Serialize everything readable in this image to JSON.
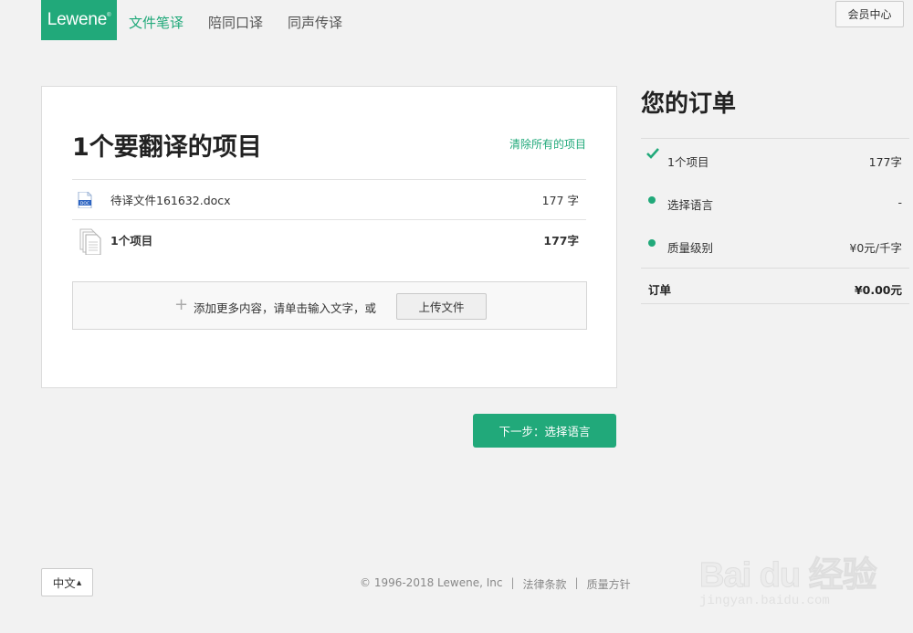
{
  "header": {
    "logo_text": "Lewene",
    "logo_mark": "®",
    "nav": [
      {
        "label": "文件笔译",
        "active": true
      },
      {
        "label": "陪同口译",
        "active": false
      },
      {
        "label": "同声传译",
        "active": false
      }
    ],
    "member_button": "会员中心"
  },
  "main": {
    "title": "1个要翻译的项目",
    "clear_link": "清除所有的项目",
    "file": {
      "name": "待译文件161632.docx",
      "count": "177 字",
      "icon": "doc-file-icon"
    },
    "summary": {
      "label": "1个项目",
      "count": "177字",
      "icon": "files-stack-icon"
    },
    "upload": {
      "plus": "+",
      "text": "添加更多内容，请单击输入文字，或",
      "button": "上传文件"
    },
    "next_button": "下一步：选择语言"
  },
  "order": {
    "title": "您的订单",
    "items": [
      {
        "label": "1个项目",
        "value": "177字",
        "status": "done"
      },
      {
        "label": "选择语言",
        "value": "-",
        "status": "pending"
      },
      {
        "label": "质量级别",
        "value": "¥0元/千字",
        "status": "pending"
      }
    ],
    "total_label": "订单",
    "total_value": "¥0.00元"
  },
  "footer": {
    "language": "中文",
    "copyright": "© 1996-2018 Lewene, Inc",
    "sep1": "|",
    "terms": "法律条款",
    "sep2": "|",
    "quality": "质量方针"
  },
  "watermark": {
    "brand": "Bai du 经验",
    "url": "jingyan.baidu.com"
  },
  "colors": {
    "accent": "#21a97a",
    "background": "#f2f2f2"
  }
}
